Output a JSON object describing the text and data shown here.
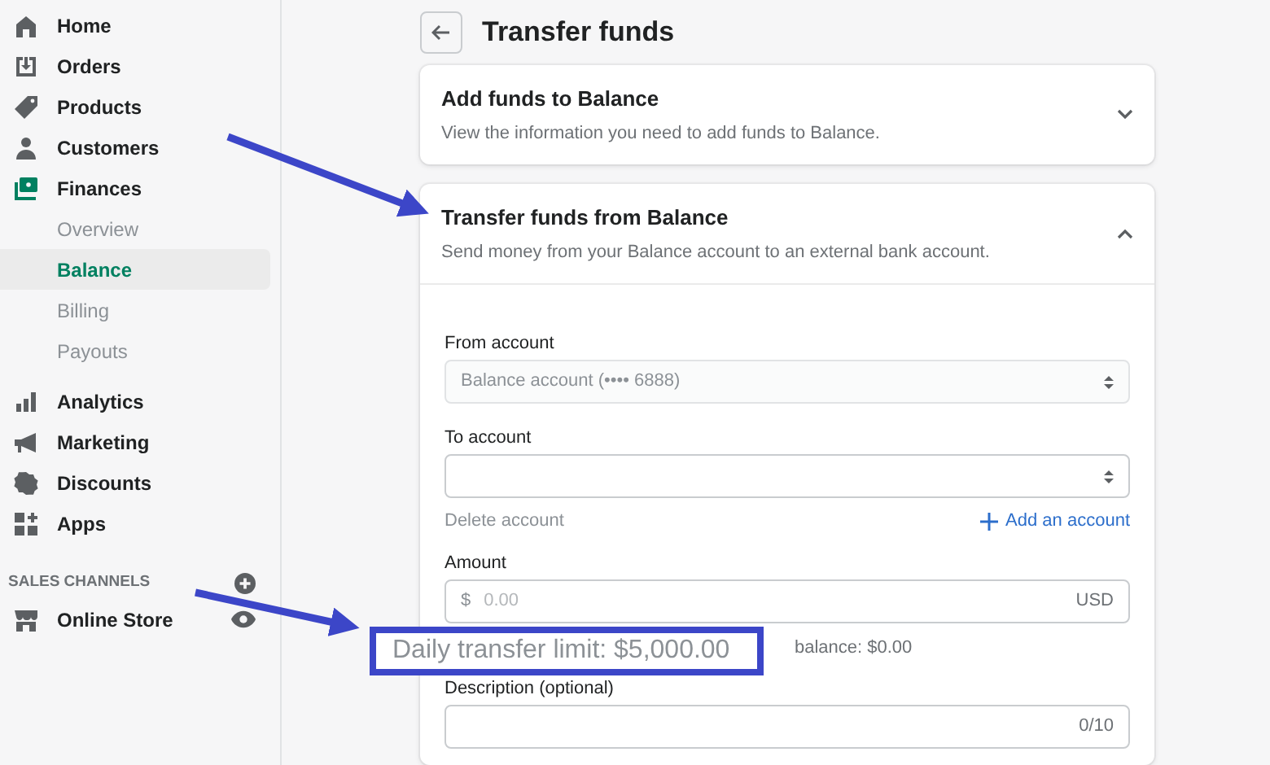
{
  "sidebar": {
    "items": [
      {
        "label": "Home",
        "kind": "home",
        "selected": false
      },
      {
        "label": "Orders",
        "kind": "orders",
        "selected": false
      },
      {
        "label": "Products",
        "kind": "tag",
        "selected": false
      },
      {
        "label": "Customers",
        "kind": "person",
        "selected": false
      },
      {
        "label": "Finances",
        "kind": "finances",
        "selected": false,
        "expanded": true,
        "children": [
          {
            "label": "Overview",
            "selected": false
          },
          {
            "label": "Balance",
            "selected": true
          },
          {
            "label": "Billing",
            "selected": false
          },
          {
            "label": "Payouts",
            "selected": false
          }
        ]
      },
      {
        "label": "Analytics",
        "kind": "bars",
        "selected": false
      },
      {
        "label": "Marketing",
        "kind": "megaphone",
        "selected": false
      },
      {
        "label": "Discounts",
        "kind": "discount",
        "selected": false
      },
      {
        "label": "Apps",
        "kind": "apps",
        "selected": false
      }
    ]
  },
  "sales_channels": {
    "title": "SALES CHANNELS",
    "items": [
      {
        "label": "Online Store",
        "selected": false
      }
    ]
  },
  "page": {
    "title": "Transfer funds",
    "sections": [
      {
        "title": "Add funds to Balance",
        "description": "View the information you need to add funds to Balance.",
        "expanded": false
      },
      {
        "title": "Transfer funds from Balance",
        "description": "Send money from your Balance account to an external bank account.",
        "expanded": true
      }
    ]
  },
  "form": {
    "from_account": {
      "label": "From account",
      "value": "Balance account (•••• 6888)",
      "disabled": true
    },
    "to_account": {
      "label": "To account"
    },
    "delete_link": "Delete account",
    "add_link": "Add an account",
    "amount": {
      "label": "Amount",
      "prefix": "$",
      "placeholder": "0.00",
      "currency": "USD",
      "help": "balance: $0.00"
    },
    "description": {
      "label": "Description (optional)",
      "counter": "0/10"
    }
  },
  "callout": {
    "text": "Daily transfer limit: $5,000.00"
  }
}
